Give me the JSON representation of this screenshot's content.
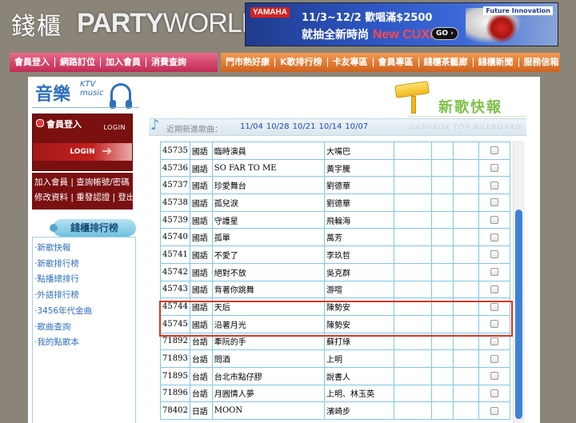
{
  "header": {
    "logo_zh": "錢櫃",
    "logo_en_party": "PARTY",
    "logo_en_world": "WORLD",
    "banner": {
      "brand": "YAMAHA",
      "line1": "11/3~12/2 歡唱滿$2500",
      "line2": "就抽全新時尚",
      "product": "New CUXi",
      "go": "GO",
      "tag": "Future Innovation"
    }
  },
  "nav_left": [
    "會員登入",
    "網路訂位",
    "加入會員",
    "消費查詢"
  ],
  "nav_right": [
    "門市熱好康",
    "K歌排行榜",
    "卡友專區",
    "會員專區",
    "錢櫃茶藝廊",
    "錢櫃新聞",
    "服務信箱"
  ],
  "sidebar": {
    "music_title": "音樂",
    "music_sub_1": "KTV",
    "music_sub_2": "music",
    "login_title": "會員登入",
    "login_en": "LOGIN",
    "login_button": "LOGIN",
    "links_row1": "加入會員 | 查詢帳號/密碼",
    "links_row2": "修改資料 | 重發認證 | 登出",
    "rank_title": "錢櫃排行榜",
    "rank_items": [
      "·新歌快報",
      "·新歌排行榜",
      "·點播總排行",
      "·外語排行榜",
      "·3456年代金曲",
      "·歌曲查詢",
      "·我的點歌本"
    ]
  },
  "main": {
    "section_title": "新歌快報",
    "list_label": "近期新進歌曲：",
    "dates": [
      "11/04",
      "10/28",
      "10/21",
      "10/14",
      "10/07"
    ],
    "billboard_label": "CASHBOX TOP BILLBOARD",
    "rows": [
      {
        "num": "45735",
        "lang": "國語",
        "song": "臨時演員",
        "artist": "大嘴巴"
      },
      {
        "num": "45736",
        "lang": "國語",
        "song": "SO FAR TO ME",
        "artist": "黃宇騰"
      },
      {
        "num": "45737",
        "lang": "國語",
        "song": "珍愛舞台",
        "artist": "劉德華"
      },
      {
        "num": "45738",
        "lang": "國語",
        "song": "孤兒淚",
        "artist": "劉德華"
      },
      {
        "num": "45739",
        "lang": "國語",
        "song": "守護星",
        "artist": "飛輪海"
      },
      {
        "num": "45740",
        "lang": "國語",
        "song": "孤單",
        "artist": "萬芳"
      },
      {
        "num": "45741",
        "lang": "國語",
        "song": "不愛了",
        "artist": "李玖哲"
      },
      {
        "num": "45742",
        "lang": "國語",
        "song": "絕對不放",
        "artist": "吳克群"
      },
      {
        "num": "45743",
        "lang": "國語",
        "song": "背著你跳舞",
        "artist": "游喧"
      },
      {
        "num": "45744",
        "lang": "國語",
        "song": "天后",
        "artist": "陳勢安"
      },
      {
        "num": "45745",
        "lang": "國語",
        "song": "沿著月光",
        "artist": "陳勢安"
      },
      {
        "num": "71892",
        "lang": "台語",
        "song": "牽阮的手",
        "artist": "蘇打綠"
      },
      {
        "num": "71893",
        "lang": "台語",
        "song": "問酒",
        "artist": "上明"
      },
      {
        "num": "71895",
        "lang": "台語",
        "song": "台北市點仔膠",
        "artist": "說書人"
      },
      {
        "num": "71896",
        "lang": "台語",
        "song": "月圓情人夢",
        "artist": "上明、林玉英"
      },
      {
        "num": "78402",
        "lang": "日語",
        "song": "MOON",
        "artist": "濱崎步"
      }
    ]
  },
  "colors": {
    "nav_left": "#c12a55",
    "nav_right": "#d0621d",
    "login_bg": "#7a1010",
    "link_blue": "#2f6fbd",
    "highlight": "#d8371f",
    "section_green": "#7dc24a"
  }
}
